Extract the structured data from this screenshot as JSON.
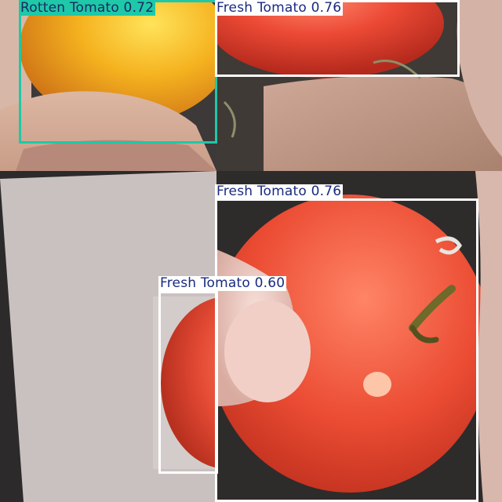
{
  "mosaic": {
    "tiles": [
      {
        "id": "tile-top-left",
        "description_icon": "yellow-tomato-in-hand"
      },
      {
        "id": "tile-top-right",
        "description_icon": "red-tomato-in-hand"
      },
      {
        "id": "tile-bottom-left",
        "description_icon": "tomato-on-gray-paper"
      },
      {
        "id": "tile-bottom-right",
        "description_icon": "red-tomato-closeup"
      }
    ]
  },
  "detections": [
    {
      "label": "Rotten Tomato 0.72",
      "class": "Rotten Tomato",
      "confidence": 0.72,
      "color": "#1ec8a8",
      "label_text_color": "#1a2a60"
    },
    {
      "label": "Fresh Tomato 0.76",
      "class": "Fresh Tomato",
      "confidence": 0.76,
      "color": "#ffffff",
      "label_text_color": "#1a2a80"
    },
    {
      "label": "Fresh Tomato 0.76",
      "class": "Fresh Tomato",
      "confidence": 0.76,
      "color": "#ffffff",
      "label_text_color": "#1a2a80"
    },
    {
      "label": "Fresh Tomato 0.60",
      "class": "Fresh Tomato",
      "confidence": 0.6,
      "color": "#ffffff",
      "label_text_color": "#1a2a80"
    }
  ]
}
